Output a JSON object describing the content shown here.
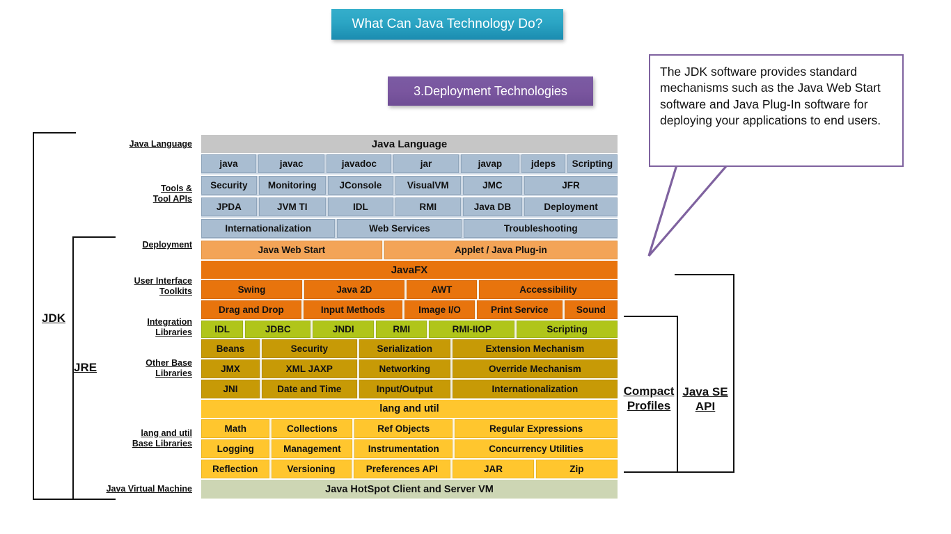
{
  "title_banner": {
    "text": "What Can Java Technology Do?"
  },
  "section_banner": {
    "text": "3.Deployment Technologies"
  },
  "callout": {
    "text": "The JDK software provides standard mechanisms such as the Java Web Start software and Java Plug-In software for deploying your applications to end users.",
    "border_color": "#7f629f"
  },
  "brackets": {
    "jdk": "JDK",
    "jre": "JRE",
    "compact_profiles_line1": "Compact",
    "compact_profiles_line2": "Profiles",
    "java_se_api_line1": "Java SE",
    "java_se_api_line2": "API"
  },
  "side_labels": {
    "java_language": "Java Language",
    "tools_line1": "Tools &",
    "tools_line2": "Tool APIs",
    "deployment": "Deployment",
    "ui_line1": "User Interface",
    "ui_line2": "Toolkits",
    "integration_line1": "Integration",
    "integration_line2": "Libraries",
    "other_base_line1": "Other Base",
    "other_base_line2": "Libraries",
    "lang_util_line1": "lang and util",
    "lang_util_line2": "Base Libraries",
    "jvm": "Java Virtual Machine"
  },
  "colors": {
    "java_language": "#c6c6c6",
    "tools": "#a9bdd1",
    "deployment": "#f3a457",
    "javafx": "#e8740d",
    "ui_toolkits": "#e8740d",
    "integration": "#b0c51a",
    "other_base": "#c79a06",
    "lang_util": "#ffc62e",
    "jvm": "#cdd6b4",
    "title_banner": "#2ba5c4",
    "section_banner": "#7a569f"
  },
  "diagram_rows": [
    {
      "band": "gray",
      "cell_class": "c-gray",
      "cells": [
        {
          "label": "Java Language",
          "flex": 100
        }
      ]
    },
    {
      "band": "tools",
      "cell_class": "c-tool",
      "cells": [
        {
          "label": "java",
          "flex": 13.6
        },
        {
          "label": "javac",
          "flex": 16.5
        },
        {
          "label": "javadoc",
          "flex": 16.1
        },
        {
          "label": "jar",
          "flex": 16.1
        },
        {
          "label": "javap",
          "flex": 14.6
        },
        {
          "label": "jdeps",
          "flex": 10.7
        },
        {
          "label": "Scripting",
          "flex": 12.4
        }
      ]
    },
    {
      "band": "tools",
      "cell_class": "c-tool",
      "cells": [
        {
          "label": "Security",
          "flex": 13.6
        },
        {
          "label": "Monitoring",
          "flex": 16.5
        },
        {
          "label": "JConsole",
          "flex": 16.1
        },
        {
          "label": "VisualVM",
          "flex": 16.1
        },
        {
          "label": "JMC",
          "flex": 14.6
        },
        {
          "label": "JFR",
          "flex": 23.1
        }
      ]
    },
    {
      "band": "tools",
      "cell_class": "c-tool",
      "cells": [
        {
          "label": "JPDA",
          "flex": 13.6
        },
        {
          "label": "JVM TI",
          "flex": 16.5
        },
        {
          "label": "IDL",
          "flex": 16.1
        },
        {
          "label": "RMI",
          "flex": 16.1
        },
        {
          "label": "Java DB",
          "flex": 14.6
        },
        {
          "label": "Deployment",
          "flex": 23.1
        }
      ]
    },
    {
      "band": "tools",
      "cell_class": "c-tool",
      "cells": [
        {
          "label": "Internationalization",
          "flex": 32.5
        },
        {
          "label": "Web Services",
          "flex": 30.2
        },
        {
          "label": "Troubleshooting",
          "flex": 37.3
        }
      ]
    },
    {
      "band": "deploy",
      "cell_class": "c-deploy",
      "cells": [
        {
          "label": "Java Web Start",
          "flex": 43.6
        },
        {
          "label": "Applet / Java Plug-in",
          "flex": 56.4
        }
      ]
    },
    {
      "band": "fx",
      "cell_class": "c-fx",
      "cells": [
        {
          "label": "JavaFX",
          "flex": 100
        }
      ]
    },
    {
      "band": "fx",
      "cell_class": "c-ui",
      "cells": [
        {
          "label": "Swing",
          "flex": 24.6
        },
        {
          "label": "Java 2D",
          "flex": 24.4
        },
        {
          "label": "AWT",
          "flex": 17.1
        },
        {
          "label": "Accessibility",
          "flex": 33.9
        }
      ]
    },
    {
      "band": "fx",
      "cell_class": "c-ui",
      "cells": [
        {
          "label": "Drag and Drop",
          "flex": 24.6
        },
        {
          "label": "Input Methods",
          "flex": 24.4
        },
        {
          "label": "Image I/O",
          "flex": 17.1
        },
        {
          "label": "Print Service",
          "flex": 21.0
        },
        {
          "label": "Sound",
          "flex": 12.9
        }
      ]
    },
    {
      "band": "green",
      "cell_class": "c-green",
      "cells": [
        {
          "label": "IDL",
          "flex": 10.2
        },
        {
          "label": "JDBC",
          "flex": 16.1
        },
        {
          "label": "JNDI",
          "flex": 15.1
        },
        {
          "label": "RMI",
          "flex": 12.4
        },
        {
          "label": "RMI-IIOP",
          "flex": 21.2
        },
        {
          "label": "Scripting",
          "flex": 25.0
        }
      ]
    },
    {
      "band": "gold",
      "cell_class": "c-gold",
      "cells": [
        {
          "label": "Beans",
          "flex": 14.1
        },
        {
          "label": "Security",
          "flex": 23.2
        },
        {
          "label": "Serialization",
          "flex": 22.2
        },
        {
          "label": "Extension Mechanism",
          "flex": 40.5
        }
      ]
    },
    {
      "band": "gold",
      "cell_class": "c-gold",
      "cells": [
        {
          "label": "JMX",
          "flex": 14.1
        },
        {
          "label": "XML JAXP",
          "flex": 23.2
        },
        {
          "label": "Networking",
          "flex": 22.2
        },
        {
          "label": "Override Mechanism",
          "flex": 40.5
        }
      ]
    },
    {
      "band": "gold",
      "cell_class": "c-gold",
      "cells": [
        {
          "label": "JNI",
          "flex": 14.1
        },
        {
          "label": "Date and Time",
          "flex": 23.2
        },
        {
          "label": "Input/Output",
          "flex": 22.2
        },
        {
          "label": "Internationalization",
          "flex": 40.5
        }
      ]
    },
    {
      "band": "amber",
      "cell_class": "c-langutil",
      "cells": [
        {
          "label": "lang and util",
          "flex": 100
        }
      ]
    },
    {
      "band": "amber",
      "cell_class": "c-amber",
      "cells": [
        {
          "label": "Math",
          "flex": 16.6
        },
        {
          "label": "Collections",
          "flex": 19.6
        },
        {
          "label": "Ref Objects",
          "flex": 23.9
        },
        {
          "label": "Regular Expressions",
          "flex": 39.9
        }
      ]
    },
    {
      "band": "amber",
      "cell_class": "c-amber",
      "cells": [
        {
          "label": "Logging",
          "flex": 16.6
        },
        {
          "label": "Management",
          "flex": 19.6
        },
        {
          "label": "Instrumentation",
          "flex": 23.9
        },
        {
          "label": "Concurrency Utilities",
          "flex": 39.9
        }
      ]
    },
    {
      "band": "amber",
      "cell_class": "c-amber",
      "cells": [
        {
          "label": "Reflection",
          "flex": 16.6
        },
        {
          "label": "Versioning",
          "flex": 19.6
        },
        {
          "label": "Preferences API",
          "flex": 23.9
        },
        {
          "label": "JAR",
          "flex": 19.9
        },
        {
          "label": "Zip",
          "flex": 20.0
        }
      ]
    },
    {
      "band": "vm",
      "cell_class": "c-vm",
      "cells": [
        {
          "label": "Java HotSpot Client and Server VM",
          "flex": 100
        }
      ]
    }
  ]
}
